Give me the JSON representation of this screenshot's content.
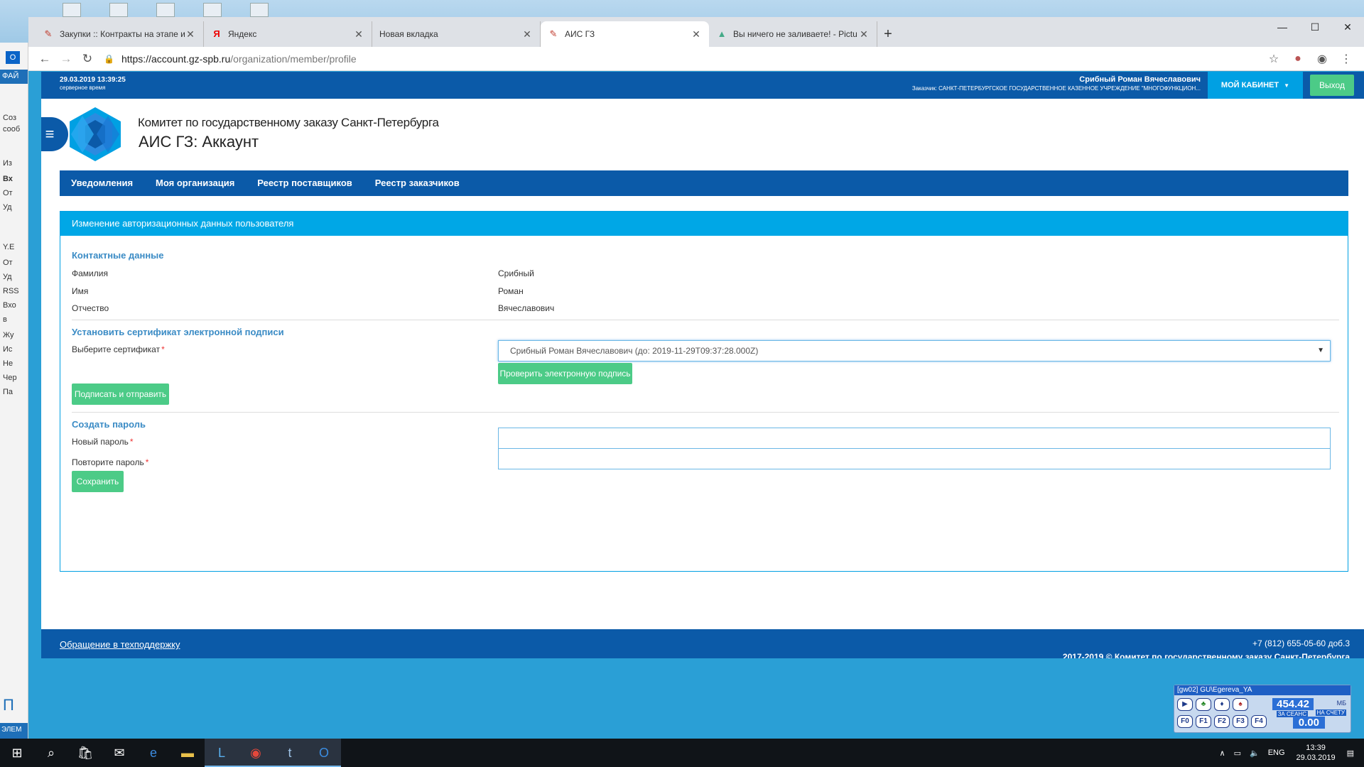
{
  "browser": {
    "tabs": [
      {
        "title": "Закупки :: Контракты на этапе и",
        "icon": "gz-icon"
      },
      {
        "title": "Яндекс",
        "icon": "yandex-icon"
      },
      {
        "title": "Новая вкладка",
        "icon": ""
      },
      {
        "title": "АИС ГЗ",
        "icon": "gz-icon"
      },
      {
        "title": "Вы ничего не заливаете! - Pictu",
        "icon": "picture-icon"
      }
    ],
    "active_tab": 3,
    "url_host": "https://account.gz-spb.ru",
    "url_path": "/organization/member/profile"
  },
  "topbar": {
    "datetime": "29.03.2019 13:39:25",
    "datetime_note": "серверное время",
    "user_name": "Срибный Роман Вячеславович",
    "user_org": "Заказчик: САНКТ-ПЕТЕРБУРГСКОЕ ГОСУДАРСТВЕННОЕ КАЗЕННОЕ УЧРЕЖДЕНИЕ \"МНОГОФУНКЦИОН...",
    "cabinet_label": "МОЙ КАБИНЕТ",
    "exit_label": "Выход"
  },
  "header": {
    "subtitle": "Комитет по государственному заказу Санкт-Петербурга",
    "title": "АИС ГЗ: Аккаунт"
  },
  "nav": [
    "Уведомления",
    "Моя организация",
    "Реестр поставщиков",
    "Реестр заказчиков"
  ],
  "panel": {
    "title": "Изменение авторизационных данных пользователя",
    "contacts_title": "Контактные данные",
    "contacts": [
      {
        "label": "Фамилия",
        "value": "Срибный"
      },
      {
        "label": "Имя",
        "value": "Роман"
      },
      {
        "label": "Отчество",
        "value": "Вячеславович"
      }
    ],
    "cert_title": "Установить сертификат электронной подписи",
    "cert_label": "Выберите сертификат",
    "cert_value": "Срибный Роман Вячеславович (до: 2019-11-29T09:37:28.000Z)",
    "verify_btn": "Проверить электронную подпись",
    "sign_btn": "Подписать и отправить",
    "pwd_title": "Создать пароль",
    "new_pwd_label": "Новый пароль",
    "repeat_pwd_label": "Повторите пароль",
    "save_btn": "Сохранить"
  },
  "footer": {
    "support": "Обращение в техподдержку",
    "phone": "+7 (812) 655-05-60 доб.3",
    "copyright": "2017-2019 © Комитет по государственному заказу Санкт-Петербурга"
  },
  "widget": {
    "title": "[gw02] GU\\Egereva_YA",
    "amount": "454.42",
    "unit": "МБ",
    "session_label": "ЗА СЕАНС",
    "account_label": "НА СЧЕТУ",
    "amount2": "0.00",
    "keys": [
      "F0",
      "F1",
      "F2",
      "F3",
      "F4"
    ]
  },
  "outlook": {
    "file": "ФАЙ",
    "items": [
      "Соз",
      "сооб",
      "Из",
      "Вх",
      "От",
      "Уд",
      "Y.E",
      "От",
      "Уд",
      "RSS",
      "Вхо",
      "в",
      "Жу",
      "Ис",
      "Не",
      "Чер",
      "Па"
    ],
    "bottom": "ЭЛЕМ",
    "side_letter": "П"
  },
  "taskbar": {
    "lang": "ENG",
    "time": "13:39",
    "date": "29.03.2019"
  }
}
